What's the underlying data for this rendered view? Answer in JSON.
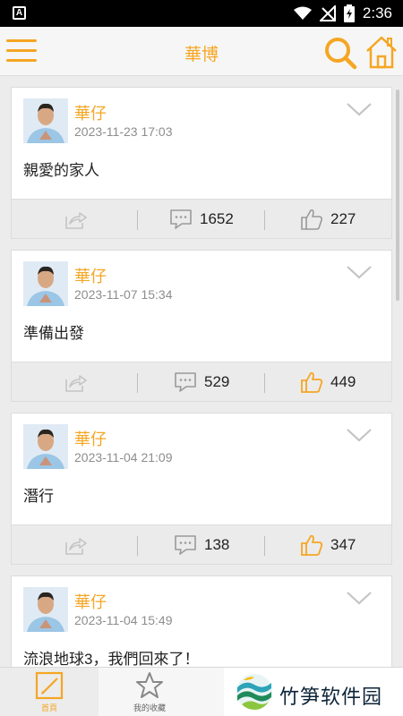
{
  "status_bar": {
    "time": "2:36",
    "app_badge": "A",
    "icons": [
      "wifi-icon",
      "signal-off-icon",
      "battery-charging-icon"
    ]
  },
  "app_bar": {
    "title": "華博",
    "icons": [
      "menu-icon",
      "search-icon",
      "home-icon"
    ],
    "accent_color": "#f5a623"
  },
  "posts": [
    {
      "author": "華仔",
      "date": "2023-11-23 17:03",
      "text": "親愛的家人",
      "comments": "1652",
      "likes": "227",
      "liked": false
    },
    {
      "author": "華仔",
      "date": "2023-11-07 15:34",
      "text": "準備出發",
      "comments": "529",
      "likes": "449",
      "liked": true
    },
    {
      "author": "華仔",
      "date": "2023-11-04 21:09",
      "text": "潛行",
      "comments": "138",
      "likes": "347",
      "liked": true
    },
    {
      "author": "華仔",
      "date": "2023-11-04 15:49",
      "text": "流浪地球3，我們回來了！",
      "comments": "",
      "likes": "",
      "liked": false
    }
  ],
  "tab_bar": {
    "tabs": [
      {
        "label": "首頁",
        "icon": "edit-icon",
        "active": true
      },
      {
        "label": "我的收藏",
        "icon": "star-icon",
        "active": false
      }
    ]
  },
  "watermark": {
    "text": "竹笋软件园",
    "icon": "bamboo-logo-icon"
  }
}
